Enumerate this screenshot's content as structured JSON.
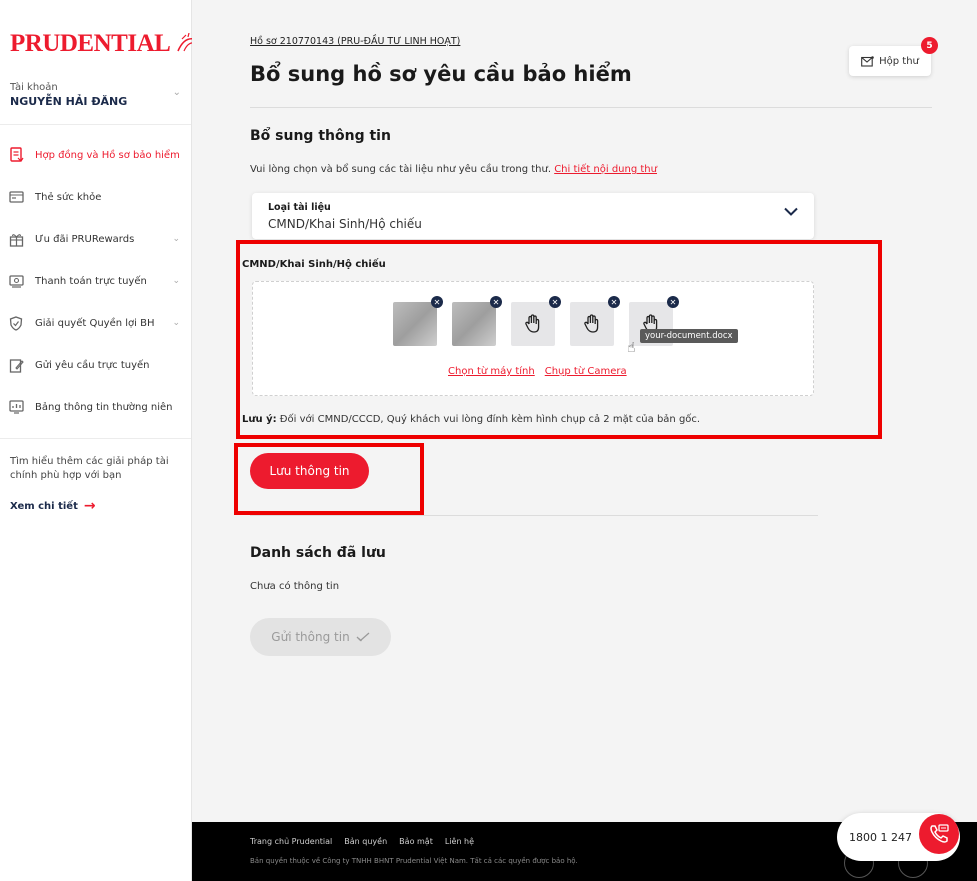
{
  "brand": {
    "name": "PRUDENTIAL",
    "color": "#ed1b2e"
  },
  "account": {
    "label": "Tài khoản",
    "name": "NGUYỄN HẢI ĐĂNG"
  },
  "sidebar": {
    "items": [
      {
        "label": "Hợp đồng và Hồ sơ bảo hiểm",
        "icon": "document-icon",
        "active": true
      },
      {
        "label": "Thẻ sức khỏe",
        "icon": "card-icon"
      },
      {
        "label": "Ưu đãi PRURewards",
        "icon": "gift-icon"
      },
      {
        "label": "Thanh toán trực tuyến",
        "icon": "payment-icon"
      },
      {
        "label": "Giải quyết Quyền lợi BH",
        "icon": "shield-icon"
      },
      {
        "label": "Gửi yêu cầu trực tuyến",
        "icon": "edit-icon"
      },
      {
        "label": "Bảng thông tin thường niên",
        "icon": "report-icon"
      }
    ],
    "promo_text": "Tìm hiểu thêm các giải pháp tài chính phù hợp với bạn",
    "promo_link": "Xem chi tiết"
  },
  "header": {
    "breadcrumb": "Hồ sơ 210770143 (PRU-ĐẦU TƯ LINH HOẠT)",
    "title": "Bổ sung hồ sơ yêu cầu bảo hiểm",
    "inbox_label": "Hộp thư",
    "inbox_count": "5"
  },
  "form": {
    "section_title": "Bổ sung thông tin",
    "instruction": "Vui lòng chọn và bổ sung các tài liệu như yêu cầu trong thư.",
    "instruction_link": "Chi tiết nội dung thư",
    "doc_type_label": "Loại tài liệu",
    "doc_type_value": "CMND/Khai Sinh/Hộ chiếu",
    "upload_label": "CMND/Khai Sinh/Hộ chiếu",
    "tooltip": "your-document.docx",
    "choose_from_computer": "Chọn từ máy tính",
    "capture_camera": "Chụp từ Camera",
    "note_bold": "Lưu ý:",
    "note_text": "Đối với CMND/CCCD, Quý khách vui lòng đính kèm hình chụp cả 2 mặt của bản gốc.",
    "save_button": "Lưu thông tin"
  },
  "saved": {
    "title": "Danh sách đã lưu",
    "empty": "Chưa có thông tin",
    "send_button": "Gửi thông tin"
  },
  "footer": {
    "links": [
      "Trang chủ Prudential",
      "Bản quyền",
      "Bảo mật",
      "Liên hệ"
    ],
    "copyright": "Bản quyền thuộc về Công ty TNHH BHNT Prudential Việt Nam. Tất cả các quyền được bảo hộ."
  },
  "hotline": "1800 1 247",
  "highlight_color": "#ee0000"
}
